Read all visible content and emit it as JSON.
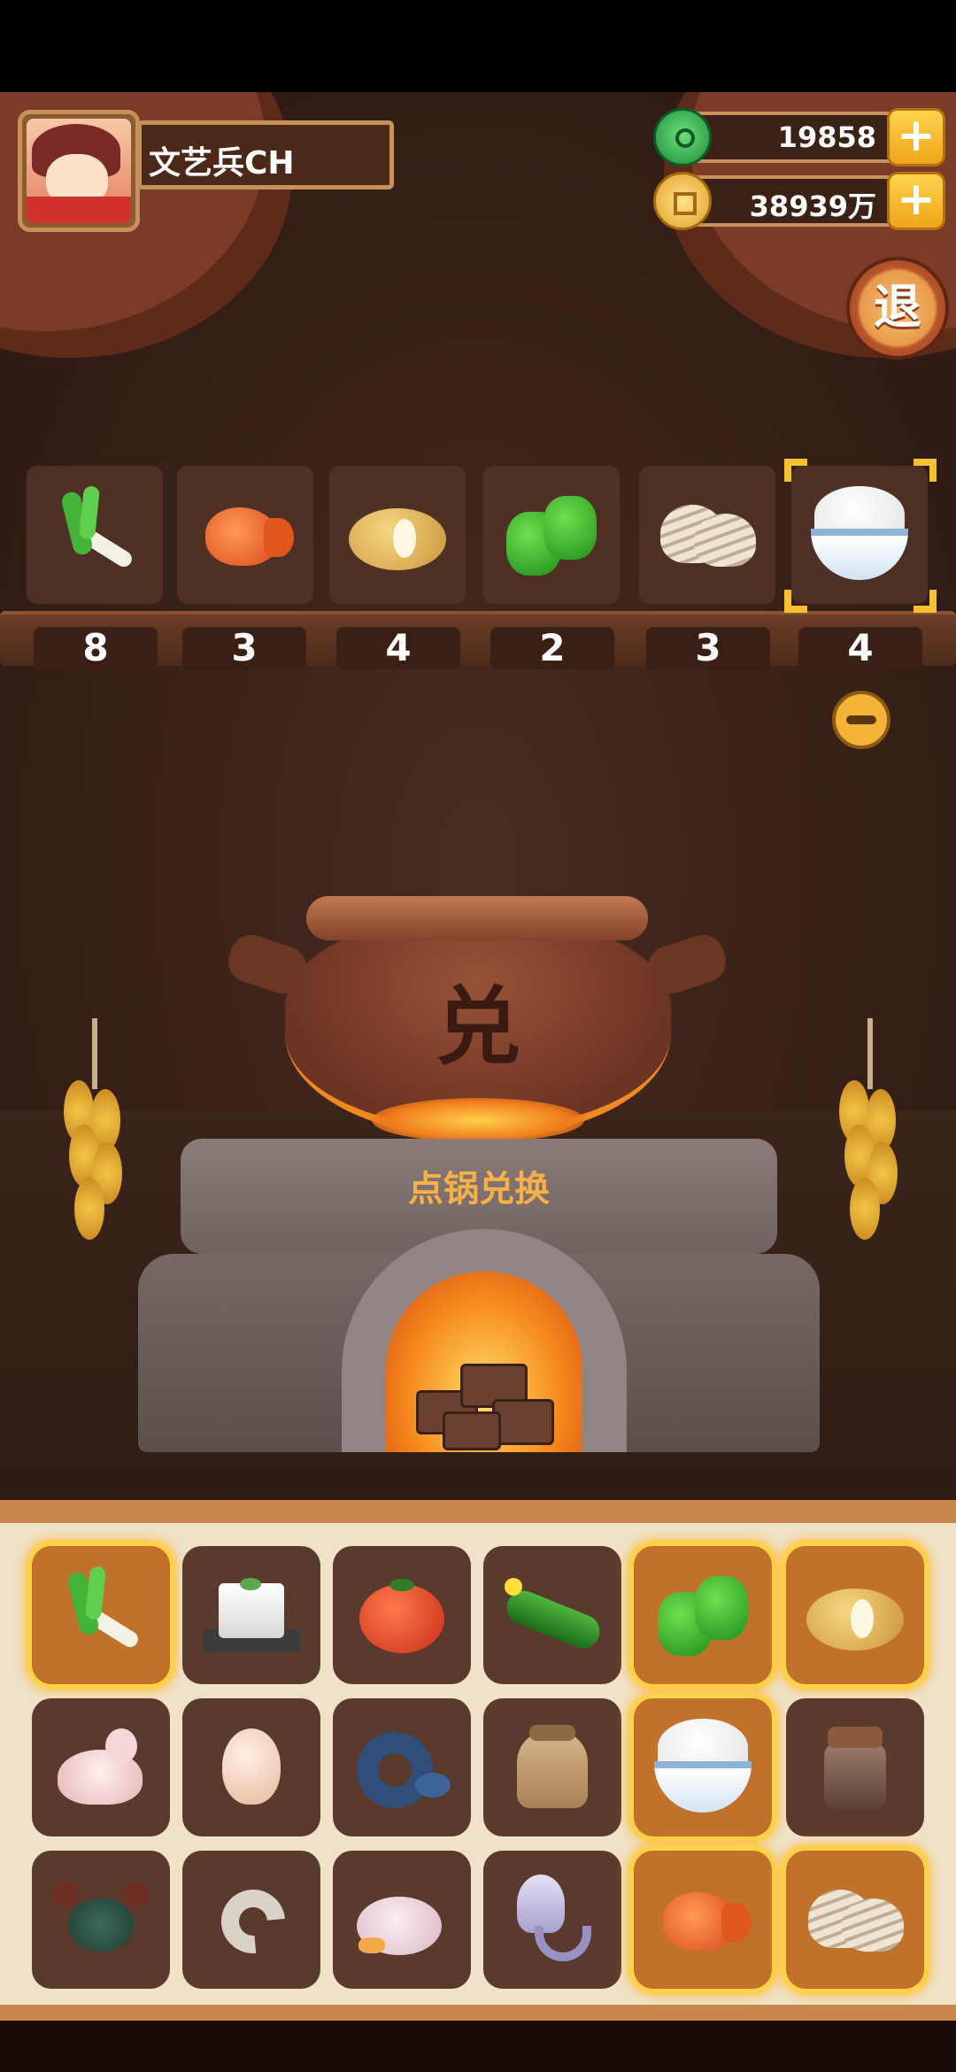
{
  "player": {
    "name": "文艺兵CH"
  },
  "currency": {
    "jade": {
      "value": "19858",
      "icon": "jade-icon"
    },
    "coins": {
      "value": "38939万",
      "icon": "coin-icon"
    }
  },
  "buttons": {
    "exit_label": "退",
    "plus_label": "+"
  },
  "selected_ingredients": [
    {
      "name": "scallion",
      "qty": "8"
    },
    {
      "name": "fish",
      "qty": "3"
    },
    {
      "name": "potato",
      "qty": "4"
    },
    {
      "name": "green-pepper",
      "qty": "2"
    },
    {
      "name": "clam",
      "qty": "3"
    },
    {
      "name": "rice",
      "qty": "4",
      "selected": true
    }
  ],
  "pot": {
    "label": "兑"
  },
  "stove": {
    "action_text": "点锅兑换"
  },
  "inventory": [
    {
      "name": "scallion",
      "highlighted": true
    },
    {
      "name": "tofu",
      "highlighted": false
    },
    {
      "name": "tomato",
      "highlighted": false
    },
    {
      "name": "cucumber",
      "highlighted": false
    },
    {
      "name": "green-pepper",
      "highlighted": true
    },
    {
      "name": "potato",
      "highlighted": true
    },
    {
      "name": "pigeon",
      "highlighted": false
    },
    {
      "name": "egg",
      "highlighted": false
    },
    {
      "name": "donut-fish",
      "highlighted": false
    },
    {
      "name": "flour-sack",
      "highlighted": false
    },
    {
      "name": "rice",
      "highlighted": true
    },
    {
      "name": "sauce-jar",
      "highlighted": false
    },
    {
      "name": "crab",
      "highlighted": false
    },
    {
      "name": "shrimp",
      "highlighted": false
    },
    {
      "name": "duck",
      "highlighted": false
    },
    {
      "name": "squid",
      "highlighted": false
    },
    {
      "name": "fish",
      "highlighted": true
    },
    {
      "name": "clam",
      "highlighted": true
    }
  ],
  "colors": {
    "highlight": "#ffd04a",
    "frame": "#c7925a",
    "scene_bg": "#3a2219"
  }
}
